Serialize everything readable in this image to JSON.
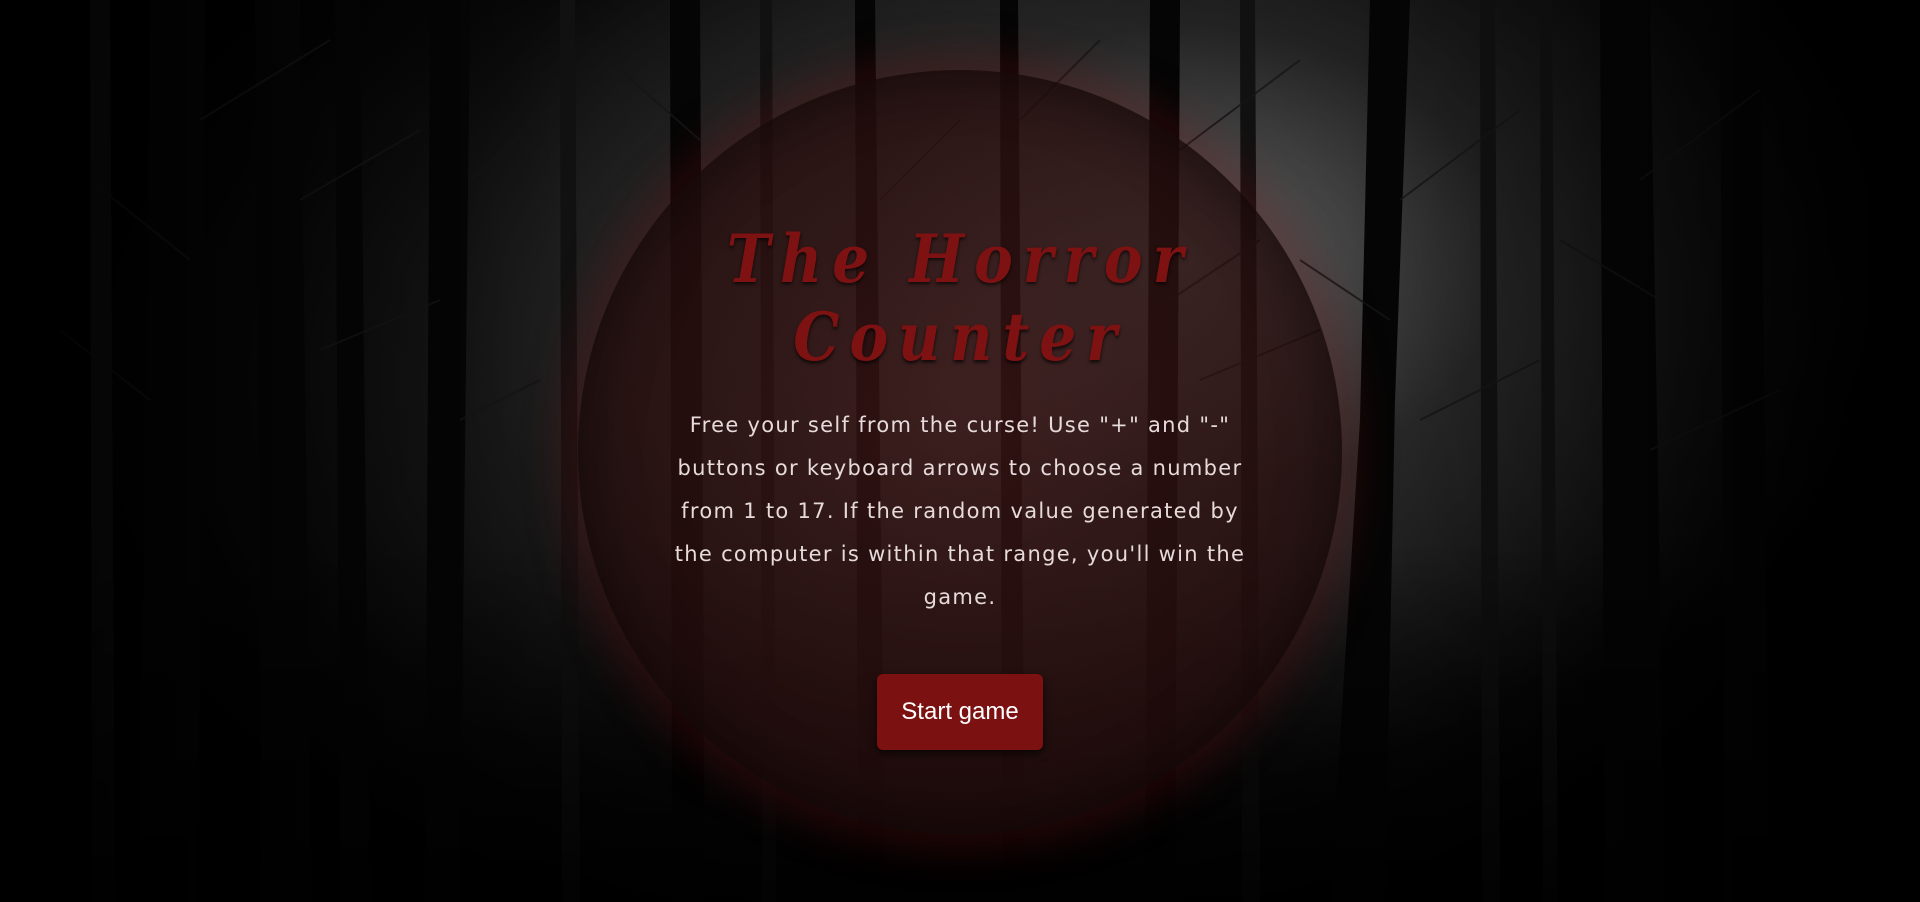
{
  "game": {
    "title": "The Horror Counter",
    "description": "Free your self from the curse! Use \"+\" and \"-\" buttons or keyboard arrows to choose a number from 1 to 17. If the random value generated by the computer is within that range, you'll win the game.",
    "start_label": "Start game"
  },
  "colors": {
    "accent": "#7c1111",
    "title": "#7e1212",
    "text": "#e6dada"
  }
}
